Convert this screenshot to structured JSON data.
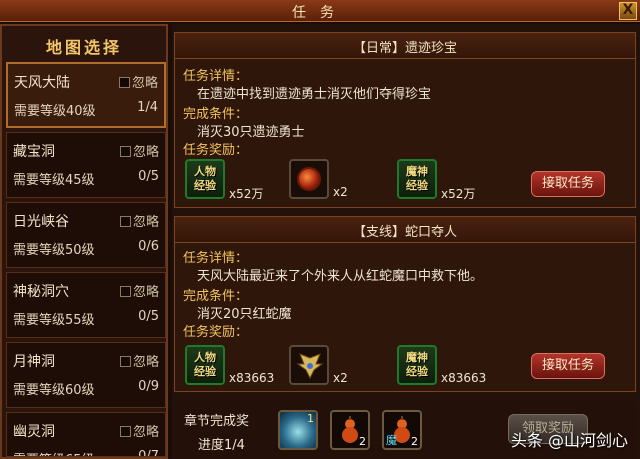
{
  "window": {
    "title": "任务",
    "close_label": "X"
  },
  "sidebar": {
    "heading": "地图选择",
    "items": [
      {
        "name": "天风大陆",
        "ignore": "忽略",
        "level": "需要等级40级",
        "progress": "1/4",
        "selected": true
      },
      {
        "name": "藏宝洞",
        "ignore": "忽略",
        "level": "需要等级45级",
        "progress": "0/5"
      },
      {
        "name": "日光峡谷",
        "ignore": "忽略",
        "level": "需要等级50级",
        "progress": "0/6"
      },
      {
        "name": "神秘洞穴",
        "ignore": "忽略",
        "level": "需要等级55级",
        "progress": "0/5"
      },
      {
        "name": "月神洞",
        "ignore": "忽略",
        "level": "需要等级60级",
        "progress": "0/9"
      },
      {
        "name": "幽灵洞",
        "ignore": "忽略",
        "level": "需要等级65级",
        "progress": "0/7"
      }
    ]
  },
  "quests": [
    {
      "title": "【日常】遗迹珍宝",
      "detail_label": "任务详情：",
      "detail": "在遗迹中找到遗迹勇士消灭他们夺得珍宝",
      "cond_label": "完成条件：",
      "cond": "消灭30只遗迹勇士",
      "reward_label": "任务奖励：",
      "rewards": [
        {
          "type": "exp",
          "line1": "人物",
          "line2": "经验",
          "qty": "x52万"
        },
        {
          "type": "gem",
          "qty": "x2"
        },
        {
          "type": "exp",
          "line1": "魔神",
          "line2": "经验",
          "qty": "x52万"
        }
      ],
      "accept": "接取任务"
    },
    {
      "title": "【支线】蛇口夺人",
      "detail_label": "任务详情：",
      "detail": "天风大陆最近来了个外来人从红蛇魔口中救下他。",
      "cond_label": "完成条件：",
      "cond": "消灭20只红蛇魔",
      "reward_label": "任务奖励：",
      "rewards": [
        {
          "type": "exp",
          "line1": "人物",
          "line2": "经验",
          "qty": "x83663"
        },
        {
          "type": "wing",
          "qty": "x2"
        },
        {
          "type": "exp",
          "line1": "魔神",
          "line2": "经验",
          "qty": "x83663"
        }
      ],
      "accept": "接取任务"
    }
  ],
  "chapter": {
    "label": "章节完成奖",
    "progress": "进度1/4",
    "rewards": [
      {
        "qty": "1"
      },
      {
        "qty": "2"
      },
      {
        "qty": "2",
        "mark": "魔"
      }
    ],
    "claim": "领取奖励"
  },
  "watermark": "头条 @山河剑心"
}
